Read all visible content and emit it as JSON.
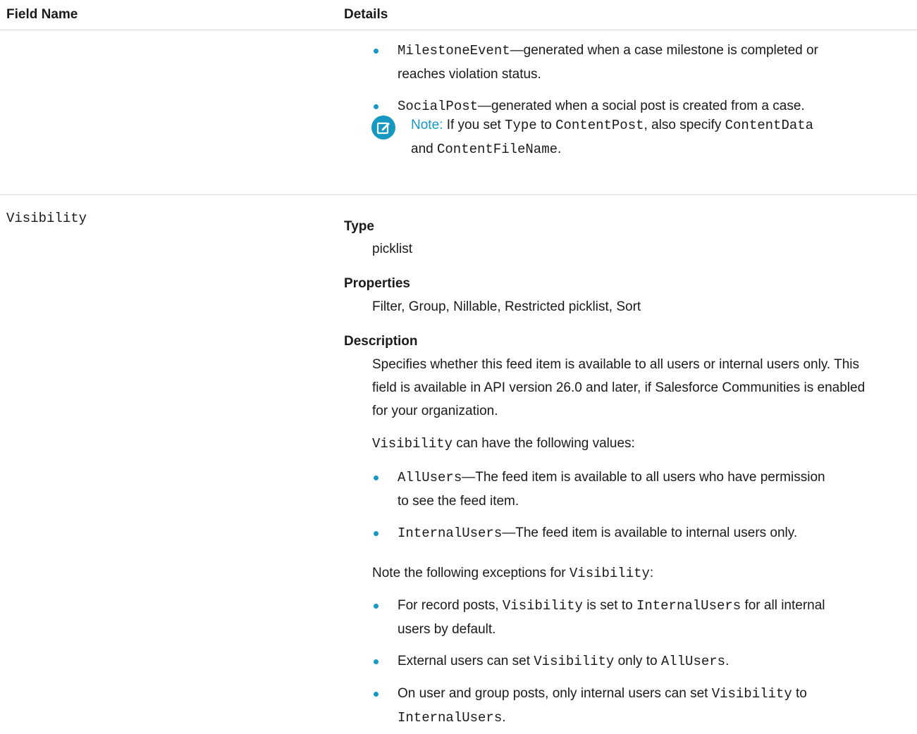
{
  "table": {
    "header": {
      "field_name": "Field Name",
      "details": "Details"
    },
    "row1": {
      "bullets": [
        {
          "code": "MilestoneEvent",
          "text_line1": "—generated when a case milestone is completed or",
          "text_line2": "reaches violation status."
        },
        {
          "code": "SocialPost",
          "text": "—generated when a social post is created from a case."
        }
      ],
      "note": {
        "label": "Note:",
        "t1": " If you set ",
        "c1": "Type",
        "t2": " to ",
        "c2": "ContentPost",
        "t3": ", also specify ",
        "c3": "ContentData",
        "t4": "and ",
        "c4": "ContentFileName",
        "t5": "."
      }
    },
    "row2": {
      "field_name": "Visibility",
      "type_label": "Type",
      "type_value": "picklist",
      "properties_label": "Properties",
      "properties_value": "Filter, Group, Nillable, Restricted picklist, Sort",
      "description_label": "Description",
      "description_lines": [
        "Specifies whether this feed item is available to all users or internal users only. This",
        "field is available in API version 26.0 and later, if Salesforce Communities is enabled",
        "for your organization."
      ],
      "values_intro_code": "Visibility",
      "values_intro_text": " can have the following values:",
      "values": [
        {
          "code": "AllUsers",
          "line1": "—The feed item is available to all users who have permission",
          "line2": "to see the feed item."
        },
        {
          "code": "InternalUsers",
          "line1": "—The feed item is available to internal users only."
        }
      ],
      "exceptions_intro_text": "Note the following exceptions for ",
      "exceptions_intro_code": "Visibility",
      "exceptions_intro_end": ":",
      "exceptions": {
        "e1": {
          "t1": "For record posts, ",
          "c1": "Visibility",
          "t2": " is set to ",
          "c2": "InternalUsers",
          "t3": " for all internal",
          "line2": "users by default."
        },
        "e2": {
          "t1": "External users can set ",
          "c1": "Visibility",
          "t2": " only to ",
          "c2": "AllUsers",
          "t3": "."
        },
        "e3": {
          "t1": "On user and group posts, only internal users can set ",
          "c1": "Visibility",
          "t2": " to",
          "c2": "InternalUsers",
          "t3": "."
        }
      }
    }
  },
  "colors": {
    "accent": "#1798c1",
    "divider": "#d8d8d8",
    "text": "#1a1a1a"
  },
  "icons": {
    "note": "edit-note-icon"
  }
}
